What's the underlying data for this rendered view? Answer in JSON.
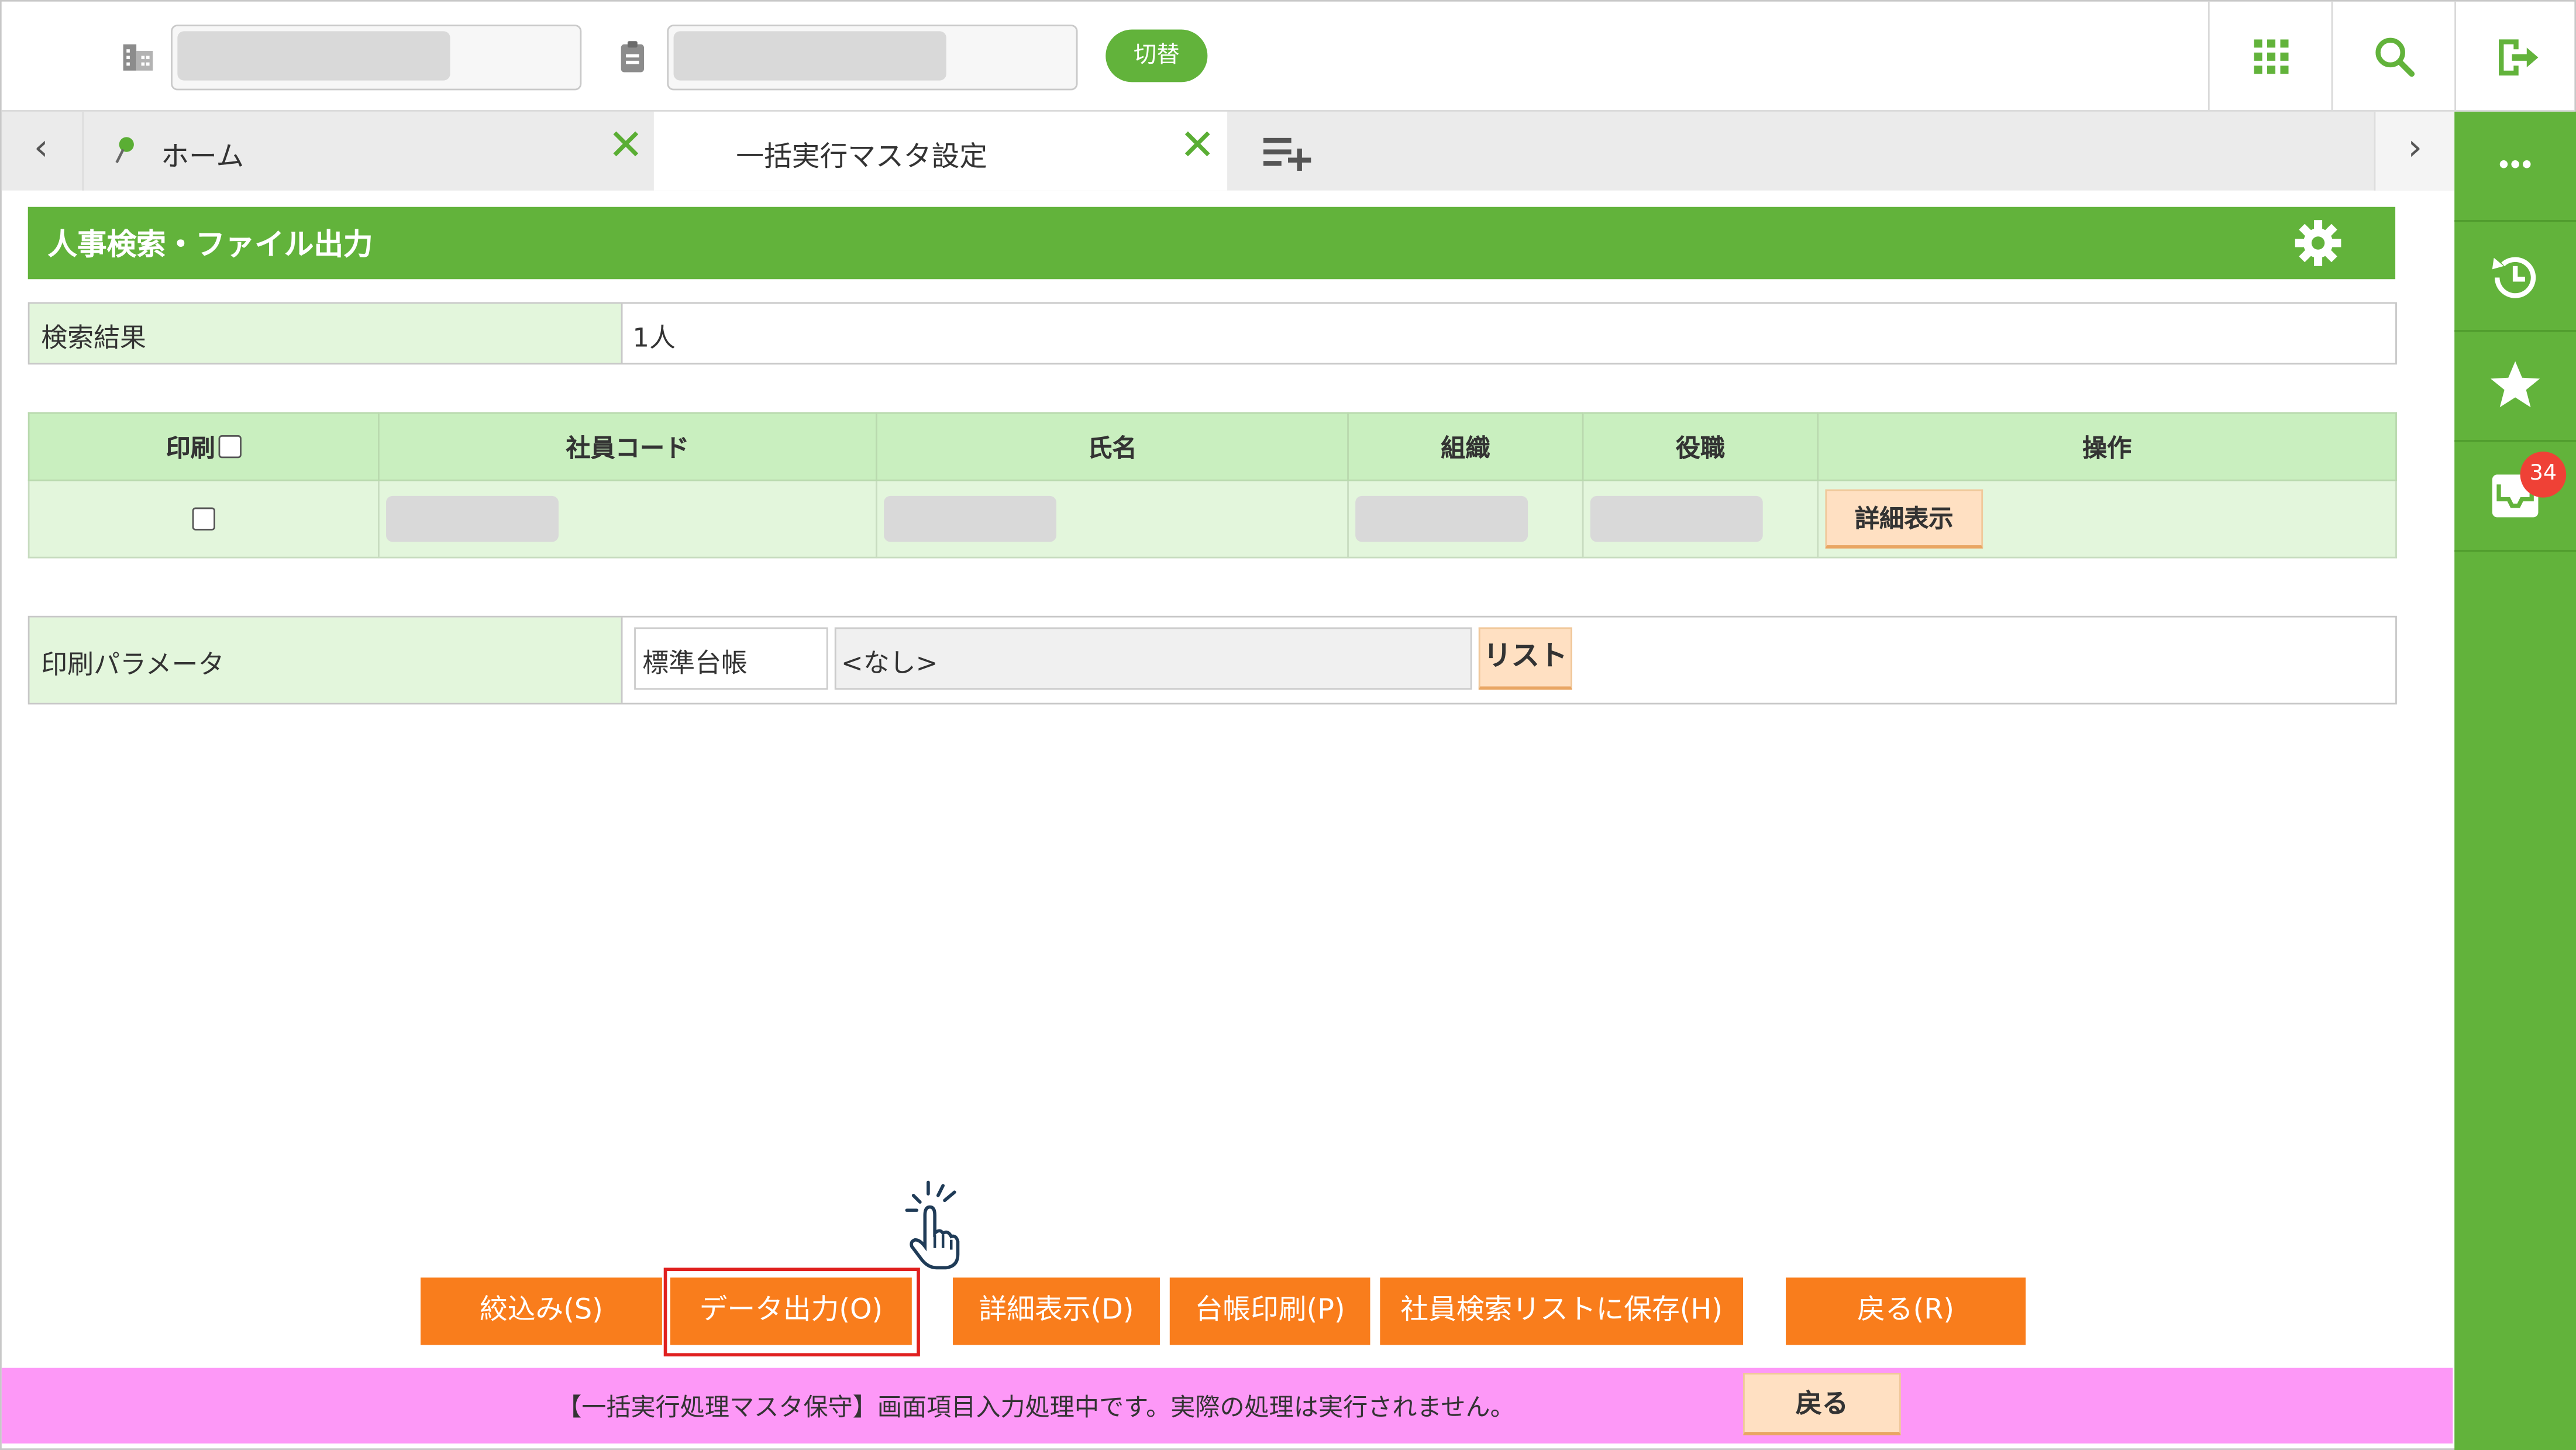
{
  "header": {
    "switch_label": "切替"
  },
  "tabs": {
    "items": [
      {
        "label": "ホーム"
      },
      {
        "label": "一括実行マスタ設定"
      }
    ]
  },
  "sidebar": {
    "badge_count": "34"
  },
  "page": {
    "title": "人事検索・ファイル出力"
  },
  "search_result": {
    "label": "検索結果",
    "value": "1人"
  },
  "table": {
    "columns": [
      "印刷",
      "社員コード",
      "氏名",
      "組織",
      "役職",
      "操作"
    ],
    "row_detail_label": "詳細表示"
  },
  "print_params": {
    "label": "印刷パラメータ",
    "ledger_value": "標準台帳",
    "none_value": "<なし>",
    "list_label": "リスト"
  },
  "actions": {
    "filter": "絞込み(S)",
    "data_output": "データ出力(O)",
    "detail": "詳細表示(D)",
    "ledger_print": "台帳印刷(P)",
    "save_list": "社員検索リストに保存(H)",
    "back": "戻る(R)"
  },
  "banner": {
    "message": "【一括実行処理マスタ保守】画面項目入力処理中です。実際の処理は実行されません。",
    "back_label": "戻る"
  },
  "colors": {
    "brand_green": "#62b33b",
    "action_orange": "#f97d1c",
    "banner_pink": "#fd98f7"
  }
}
